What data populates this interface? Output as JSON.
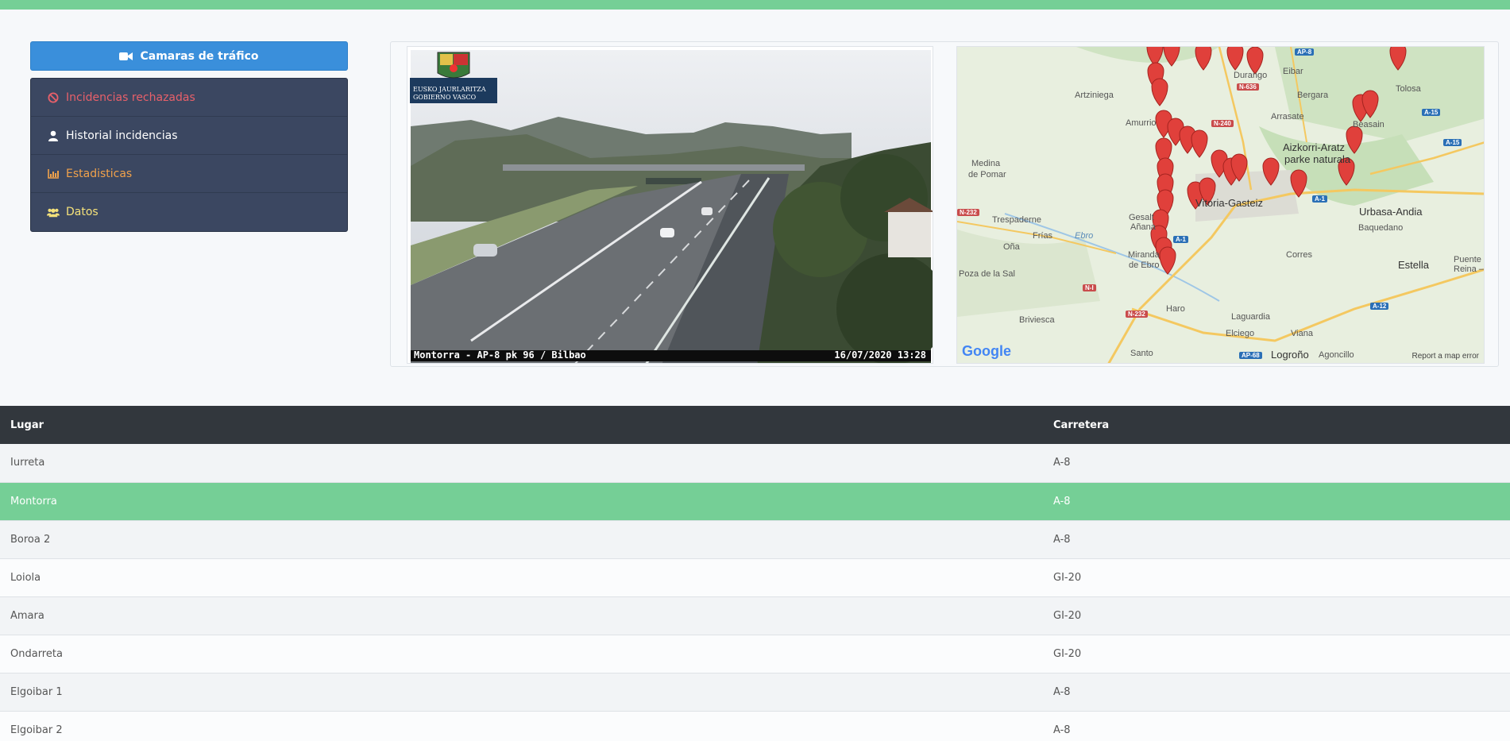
{
  "colors": {
    "topbar": "#75cf96",
    "primary_button": "#3a8fdb",
    "menu_bg": "#3b4761",
    "selected_row": "#75cf96",
    "table_header": "#32373d"
  },
  "sidebar": {
    "cameras_button": {
      "label": "Camaras de tráfico",
      "icon": "video-camera-icon"
    },
    "menu": [
      {
        "label": "Incidencias rechazadas",
        "icon": "ban-icon",
        "color": "#e8606a"
      },
      {
        "label": "Historial incidencias",
        "icon": "user-icon",
        "color": "#ffffff"
      },
      {
        "label": "Estadisticas",
        "icon": "chart-icon",
        "color": "#f1a24b"
      },
      {
        "label": "Datos",
        "icon": "users-icon",
        "color": "#f5e27a"
      }
    ]
  },
  "camera": {
    "logo_line1": "EUSKO JAURLARITZA",
    "logo_line2": "GOBIERNO VASCO",
    "caption_location": "Montorra - AP-8 pk 96 / Bilbao",
    "caption_timestamp": "16/07/2020 13:28"
  },
  "map": {
    "labels": {
      "artziniega": "Artziniega",
      "amurrio": "Amurrio",
      "durango": "Durango",
      "eibar": "Eibar",
      "bergara": "Bergara",
      "arrasate": "Arrasate",
      "tolosa": "Tolosa",
      "beasain": "Beasain",
      "aizkorri": "Aizkorri-Aratz",
      "aizkorri2": "parke naturala",
      "medina1": "Medina",
      "medina2": "de Pomar",
      "trespaderne": "Trespaderne",
      "frias": "Frías",
      "ebro": "Ebro",
      "ona": "Oña",
      "poza": "Poza de la Sal",
      "gasteiz": "Vitoria-Gasteiz",
      "urbasa": "Urbasa-Andia",
      "baquedano": "Baquedano",
      "corres": "Corres",
      "estella": "Estella",
      "puente1": "Puente",
      "puente2": "Reina – G",
      "miranda1": "Miranda",
      "miranda2": "de Ebro",
      "briviesca": "Briviesca",
      "haro": "Haro",
      "laguardia": "Laguardia",
      "elciego": "Elciego",
      "viana": "Viana",
      "logrono": "Logroño",
      "agoncillo": "Agoncillo",
      "santo": "Santo",
      "gesalt": "Gesalt",
      "anana": "Añana"
    },
    "roads": [
      "AP-8",
      "N-636",
      "N-240",
      "A-15",
      "A-15",
      "A-1",
      "N-232",
      "A-1",
      "N-I",
      "N-232",
      "A-12",
      "AP-68"
    ],
    "google_label": "Google",
    "error_link": "Report a map error"
  },
  "table": {
    "headers": [
      "Lugar",
      "Carretera"
    ],
    "selected_index": 1,
    "rows": [
      {
        "lugar": "Iurreta",
        "carretera": "A-8"
      },
      {
        "lugar": "Montorra",
        "carretera": "A-8"
      },
      {
        "lugar": "Boroa 2",
        "carretera": "A-8"
      },
      {
        "lugar": "Loiola",
        "carretera": "GI-20"
      },
      {
        "lugar": "Amara",
        "carretera": "GI-20"
      },
      {
        "lugar": "Ondarreta",
        "carretera": "GI-20"
      },
      {
        "lugar": "Elgoibar 1",
        "carretera": "A-8"
      },
      {
        "lugar": "Elgoibar 2",
        "carretera": "A-8"
      }
    ]
  }
}
